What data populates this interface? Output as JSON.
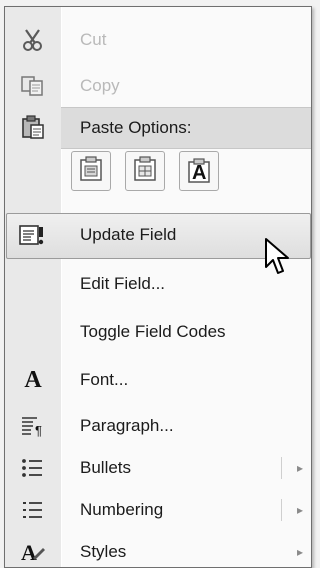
{
  "menu": {
    "cut": {
      "label": "Cut",
      "icon": "scissors-icon",
      "enabled": false
    },
    "copy": {
      "label": "Copy",
      "icon": "copy-icon",
      "enabled": false
    },
    "paste_options": {
      "label": "Paste Options:",
      "icon": "clipboard-icon",
      "buttons": [
        {
          "icon": "paste-keep-formatting-icon"
        },
        {
          "icon": "paste-merge-formatting-icon"
        },
        {
          "icon": "paste-text-only-icon",
          "glyph": "A"
        }
      ]
    },
    "update_field": {
      "label": "Update Field",
      "icon": "update-field-icon",
      "highlighted": true
    },
    "edit_field": {
      "label": "Edit Field..."
    },
    "toggle_field_codes": {
      "label": "Toggle Field Codes"
    },
    "font": {
      "label": "Font...",
      "icon": "font-icon",
      "icon_glyph": "A"
    },
    "paragraph": {
      "label": "Paragraph...",
      "icon": "paragraph-icon"
    },
    "bullets": {
      "label": "Bullets",
      "icon": "bullets-icon",
      "has_submenu": true
    },
    "numbering": {
      "label": "Numbering",
      "icon": "numbering-icon",
      "has_submenu": true
    },
    "styles": {
      "label": "Styles",
      "icon": "styles-icon",
      "has_submenu": true
    },
    "submenu_arrow": "▸"
  }
}
